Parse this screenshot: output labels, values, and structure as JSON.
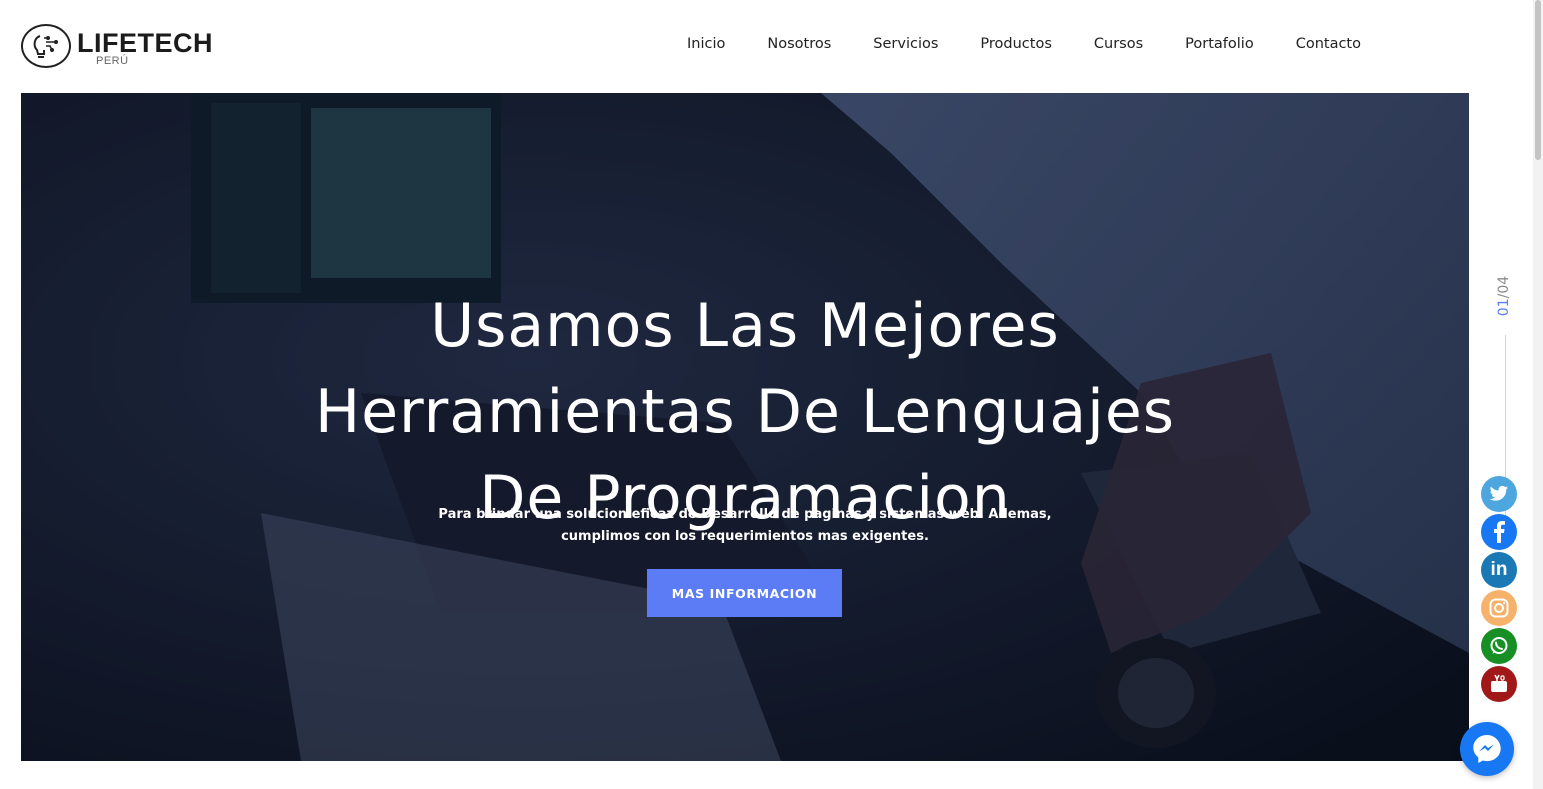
{
  "brand": {
    "name": "LIFETECH",
    "subtitle": "PERÚ"
  },
  "nav": {
    "items": [
      "Inicio",
      "Nosotros",
      "Servicios",
      "Productos",
      "Cursos",
      "Portafolio",
      "Contacto"
    ]
  },
  "hero": {
    "title_lines": [
      "Usamos Las Mejores",
      "Herramientas De Lenguajes",
      "De Programacion"
    ],
    "subtitle_lines": [
      "Para brindar una solucion eficaz de Desarrollo de paginas y sistemas web. Ademas,",
      "cumplimos con los requerimientos mas exigentes."
    ],
    "button_label": "MAS INFORMACION"
  },
  "slider": {
    "current": "01",
    "separator": "/",
    "total": "04"
  },
  "social": [
    "twitter-icon",
    "facebook-icon",
    "linkedin-icon",
    "instagram-icon",
    "whatsapp-icon",
    "youtube-icon"
  ],
  "colors": {
    "accent": "#5b7cf5",
    "twitter": "#4da7de",
    "facebook": "#1877f2",
    "linkedin": "#1a78b5",
    "instagram": "#f6b26b",
    "whatsapp": "#188f24",
    "youtube": "#a01818"
  }
}
